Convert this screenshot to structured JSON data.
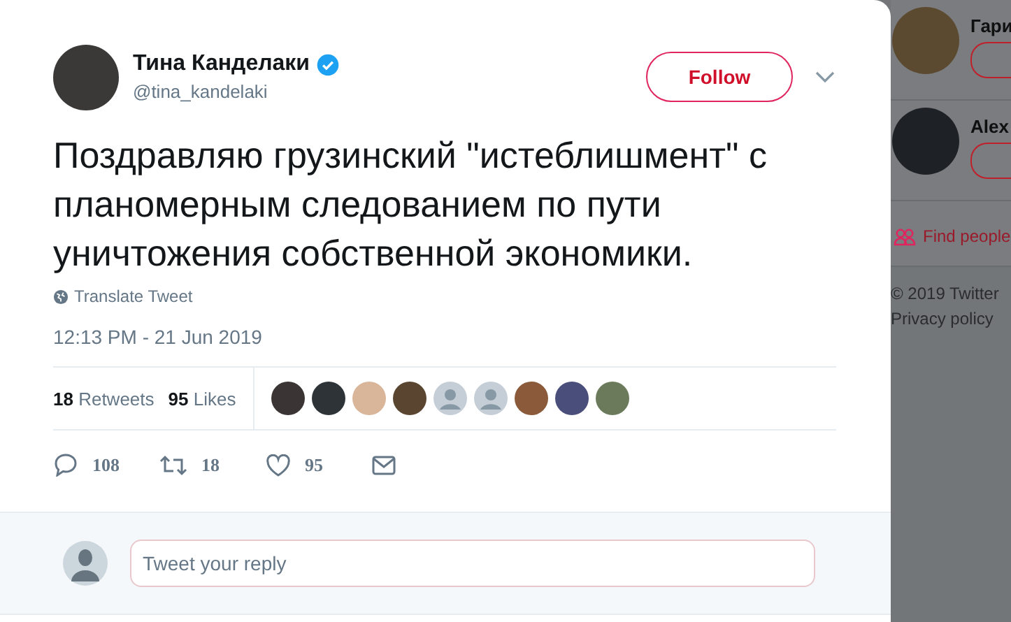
{
  "tweet": {
    "name": "Тина Канделаки",
    "verified": true,
    "handle": "@tina_kandelaki",
    "follow_button": "Follow",
    "text": "Поздравляю грузинский \"истеблишмент\" с планомерным следованием по пути уничтожения собственной экономики.",
    "translate": "Translate Tweet",
    "timestamp": "12:13 PM - 21 Jun 2019",
    "stats": [
      {
        "count": "18",
        "label": "Retweets"
      },
      {
        "count": "95",
        "label": "Likes"
      }
    ],
    "likers": [
      {
        "kind": "photo"
      },
      {
        "kind": "photo"
      },
      {
        "kind": "photo"
      },
      {
        "kind": "photo"
      },
      {
        "kind": "default"
      },
      {
        "kind": "default"
      },
      {
        "kind": "photo"
      },
      {
        "kind": "photo"
      },
      {
        "kind": "photo"
      }
    ],
    "actions": [
      {
        "kind": "reply",
        "count": "108"
      },
      {
        "kind": "retweet",
        "count": "18"
      },
      {
        "kind": "like",
        "count": "95"
      },
      {
        "kind": "message"
      }
    ]
  },
  "reply": {
    "placeholder": "Tweet your reply"
  },
  "sidebar": {
    "accounts": [
      {
        "name": "Гари"
      },
      {
        "name": "Alex"
      }
    ],
    "find_people": "Find people",
    "footer": [
      "© 2019 Twitter",
      "Privacy policy"
    ]
  }
}
